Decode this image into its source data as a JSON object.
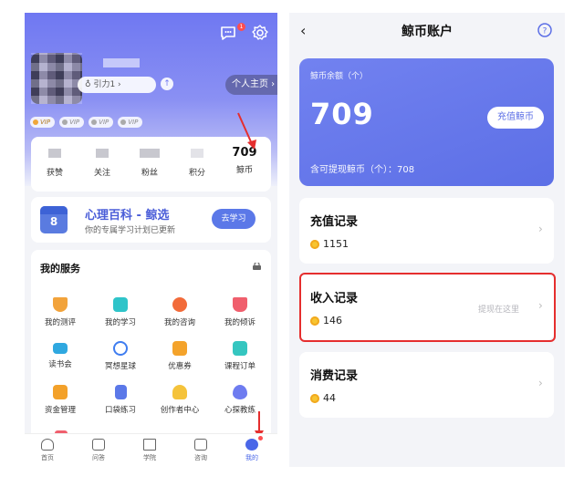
{
  "left_app": {
    "header": {
      "notification_badge": "1"
    },
    "profile": {
      "power_label": "引力1",
      "homepage_button": "个人主页 ›"
    },
    "vip_badges": [
      "VIP",
      "VIP",
      "VIP",
      "VIP"
    ],
    "stats": [
      {
        "label": "获赞",
        "value": ""
      },
      {
        "label": "关注",
        "value": ""
      },
      {
        "label": "粉丝",
        "value": ""
      },
      {
        "label": "积分",
        "value": ""
      },
      {
        "label": "鲸币",
        "value": "709"
      }
    ],
    "banner": {
      "title": "心理百科 - 鲸选",
      "subtitle": "你的专属学习计划已更新",
      "button": "去学习",
      "calendar_day": "8"
    },
    "services": {
      "title": "我的服务",
      "items": [
        {
          "label": "我的测评",
          "icon": "flask-icon",
          "color": "#f2a33b"
        },
        {
          "label": "我的学习",
          "icon": "video-icon",
          "color": "#2fc4c9"
        },
        {
          "label": "我的咨询",
          "icon": "chat-icon",
          "color": "#f26b3a"
        },
        {
          "label": "我的倾诉",
          "icon": "cup-icon",
          "color": "#f05f6d"
        },
        {
          "label": "读书会",
          "icon": "graduation-cap-icon",
          "color": "#2fa8e0"
        },
        {
          "label": "冥想星球",
          "icon": "planet-icon",
          "color": "#3f7df0"
        },
        {
          "label": "优惠券",
          "icon": "coupon-icon",
          "color": "#f4a32b"
        },
        {
          "label": "课程订单",
          "icon": "list-icon",
          "color": "#35c6c0"
        },
        {
          "label": "资金管理",
          "icon": "wallet-icon",
          "color": "#f3a12a"
        },
        {
          "label": "口袋练习",
          "icon": "pocket-icon",
          "color": "#5b78e8"
        },
        {
          "label": "创作者中心",
          "icon": "bulb-icon",
          "color": "#f5c33b"
        },
        {
          "label": "心探教练",
          "icon": "heart-icon",
          "color": "#6e7cf0"
        }
      ]
    },
    "tabbar": [
      {
        "label": "首页",
        "icon": "home-icon",
        "active": false
      },
      {
        "label": "问答",
        "icon": "qa-icon",
        "active": false
      },
      {
        "label": "学院",
        "icon": "books-icon",
        "active": false
      },
      {
        "label": "咨询",
        "icon": "consult-icon",
        "active": false
      },
      {
        "label": "我的",
        "icon": "profile-icon",
        "active": true
      }
    ]
  },
  "right_app": {
    "title": "鲸币账户",
    "balance_label": "鲸币余额（个）",
    "balance": "709",
    "recharge_button": "充值鲸币",
    "withdrawable": "含可提现鲸币（个）：708",
    "records": [
      {
        "title": "充值记录",
        "value": "1151",
        "hint": ""
      },
      {
        "title": "收入记录",
        "value": "146",
        "hint": "提现在这里"
      },
      {
        "title": "消费记录",
        "value": "44",
        "hint": ""
      }
    ],
    "colors": {
      "accent": "#5c6fe6",
      "highlight_box": "#e52e2e"
    }
  }
}
